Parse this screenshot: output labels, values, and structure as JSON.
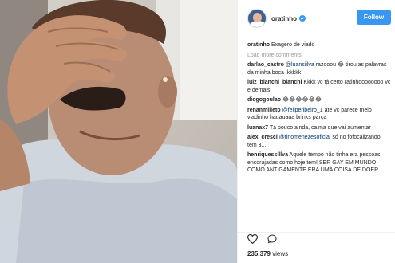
{
  "post": {
    "username": "oratinho",
    "follow_label": "Follow",
    "caption_user": "oratinho",
    "caption_text": "Exagero de viado",
    "load_more": "Load more comments",
    "views_count": "235,379",
    "views_label": "views"
  },
  "comments": [
    {
      "user": "darlao_castro",
      "mention": "@luansiilva",
      "text": " razooou 😂 tirou as palavras da minha boca .kkkkk"
    },
    {
      "user": "luiz_bianchi_bianchi",
      "mention": "",
      "text": "Kkkk vc tá certo ratinhoooooooo vc e demais"
    },
    {
      "user": "diogogoulao",
      "mention": "",
      "text": "😂😂😂😂😂😂"
    },
    {
      "user": "renanmilleto",
      "mention": "@feliperibeiro_1",
      "text": " ate vc parece meio viadinho hauauaua brinks parça"
    },
    {
      "user": "luanax7",
      "mention": "",
      "text": "Tá pouco ainda, calma que vai aumentar"
    },
    {
      "user": "alex_cresci",
      "mention": "@tinomenezesoficial",
      "text": " só no fofocalizando tem 3..."
    },
    {
      "user": "henriquessillva",
      "mention": "",
      "text": "Aquele tempo não tinha era pessoas encorajadas como hoje tem! SER GAY EM MUNDO COMO ANTIGAMENTE ERA UMA COISA DE DOER"
    }
  ],
  "colors": {
    "accent": "#3897f0",
    "link": "#003569",
    "muted": "#999999"
  }
}
